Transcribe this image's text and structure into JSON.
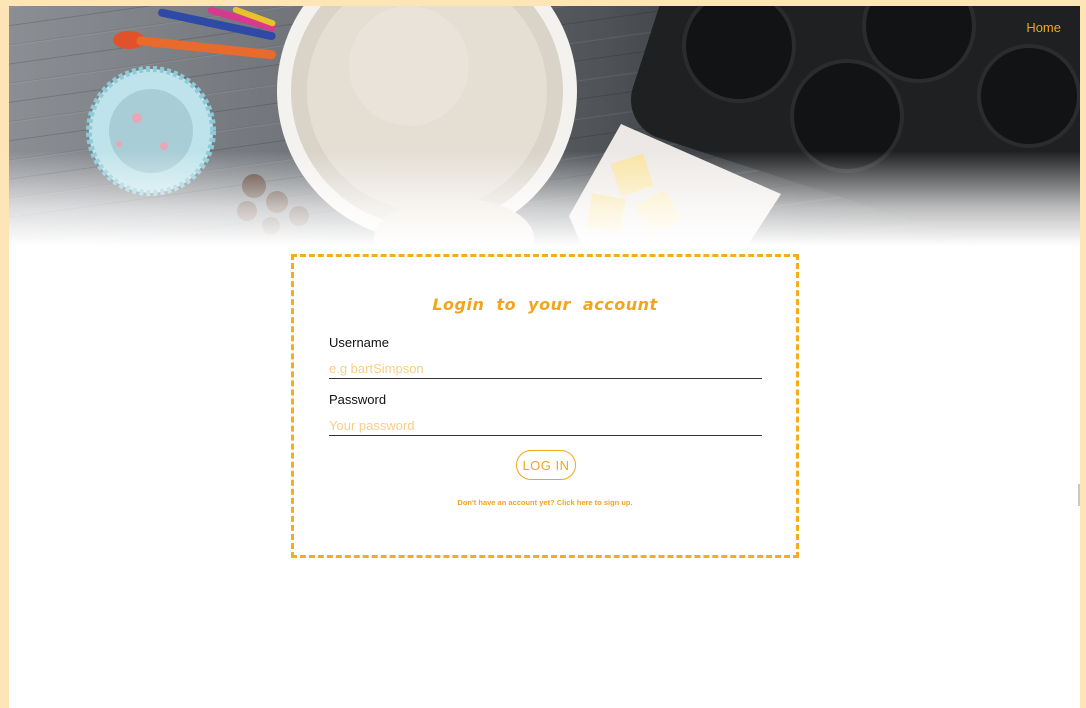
{
  "nav": {
    "home_label": "Home"
  },
  "login": {
    "title": "Login to your account",
    "username_label": "Username",
    "username_placeholder": "e.g bartSimpson",
    "password_label": "Password",
    "password_placeholder": "Your password",
    "submit_label": "LOG IN",
    "signup_text": "Don't have an account yet? Click here to sign up."
  },
  "colors": {
    "accent": "#f0a51d",
    "card_border": "#f6ad1b",
    "page_frame": "#fde5b8",
    "placeholder": "#f7ce86"
  }
}
